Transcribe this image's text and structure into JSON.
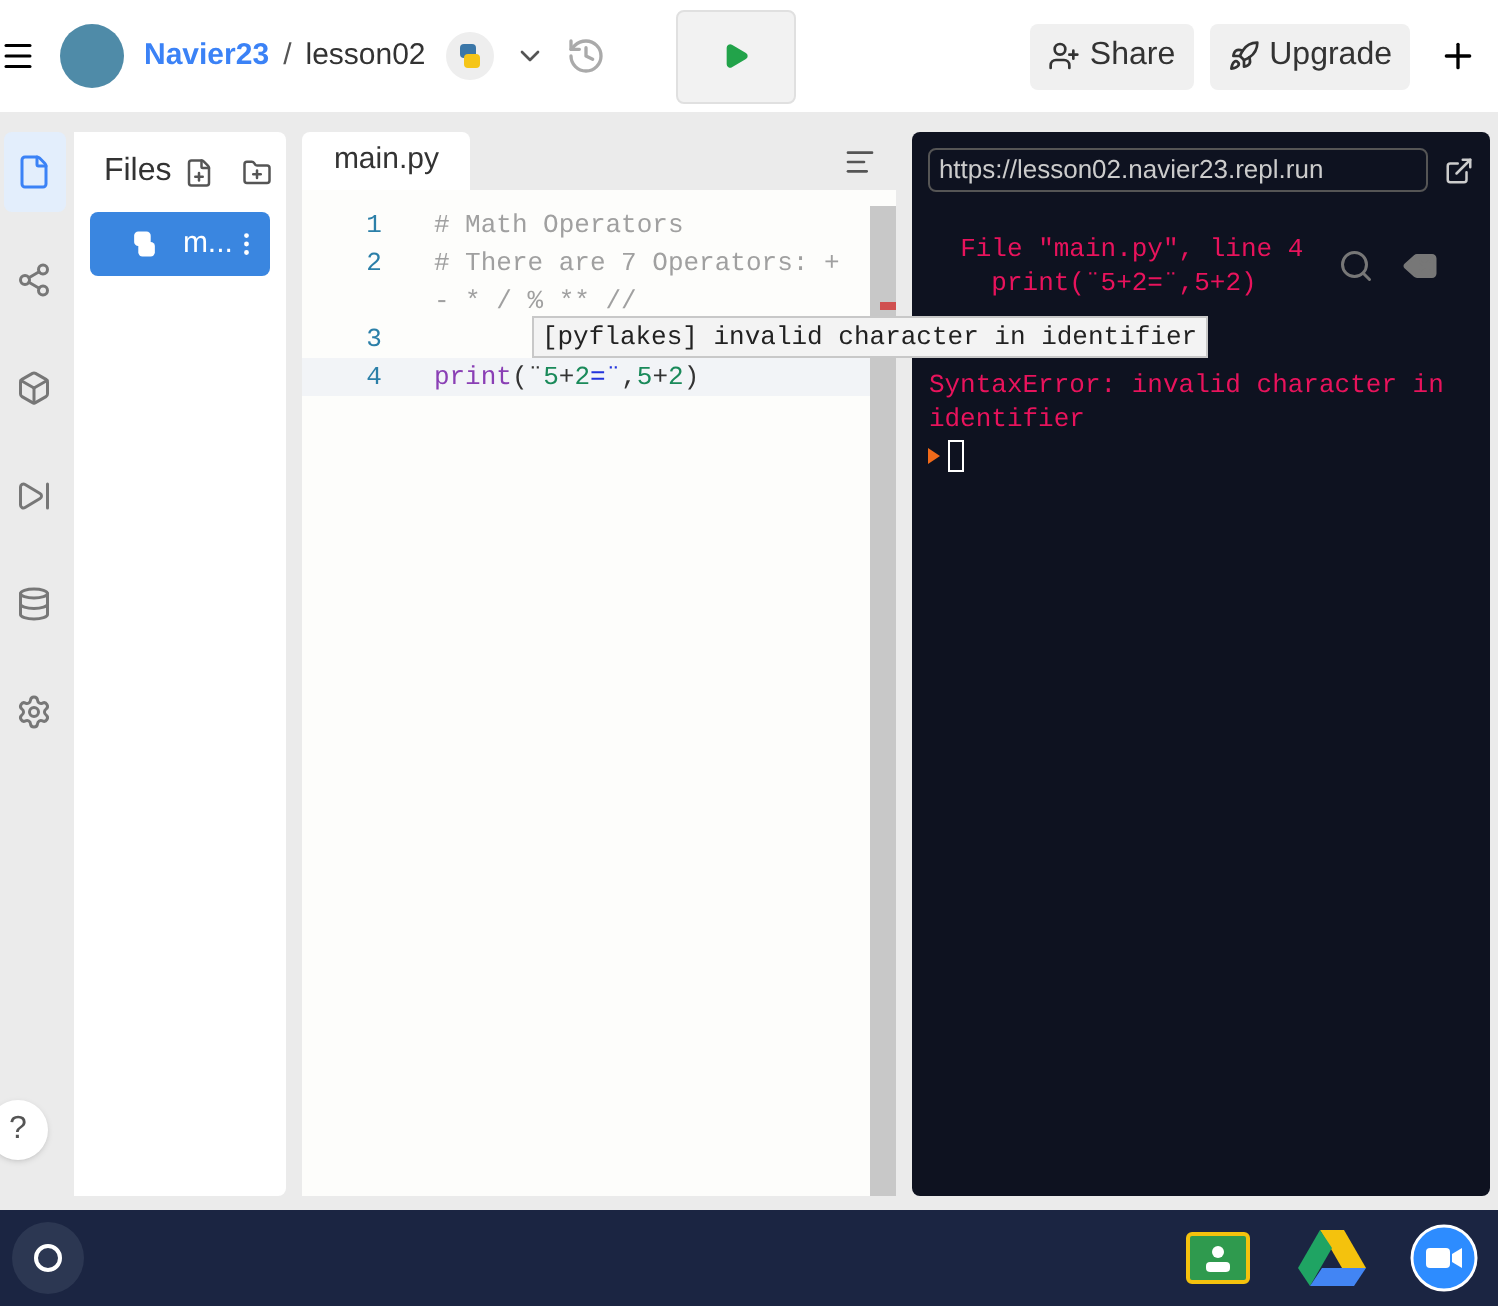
{
  "header": {
    "user": "Navier23",
    "separator": "/",
    "repl": "lesson02",
    "share": "Share",
    "upgrade": "Upgrade"
  },
  "rail": [
    {
      "kind": "files",
      "selected": true
    },
    {
      "kind": "share",
      "selected": false
    },
    {
      "kind": "packages",
      "selected": false
    },
    {
      "kind": "debugger",
      "selected": false
    },
    {
      "kind": "database",
      "selected": false
    },
    {
      "kind": "settings",
      "selected": false
    }
  ],
  "help": "?",
  "files": {
    "title": "Files",
    "items": [
      {
        "name": "m...",
        "selected": true
      }
    ]
  },
  "editor": {
    "tab": "main.py",
    "lines": [
      {
        "number": "1",
        "parts": [
          {
            "kind": "comment",
            "text": "# Math Operators"
          }
        ]
      },
      {
        "number": "2",
        "parts": [
          {
            "kind": "comment",
            "text": "# There are 7 Operators: + - * / % ** //"
          }
        ]
      },
      {
        "number": "3"
      },
      {
        "number": "4",
        "parts": [
          {
            "kind": "func",
            "text": "print"
          },
          {
            "kind": "plain",
            "text": "(¨"
          },
          {
            "kind": "num",
            "text": "5"
          },
          {
            "kind": "plain",
            "text": "+"
          },
          {
            "kind": "num",
            "text": "2"
          },
          {
            "kind": "op",
            "text": "=¨"
          },
          {
            "kind": "plain",
            "text": ","
          },
          {
            "kind": "num",
            "text": "5"
          },
          {
            "kind": "plain",
            "text": "+"
          },
          {
            "kind": "num",
            "text": "2"
          },
          {
            "kind": "plain",
            "text": ")"
          }
        ]
      }
    ],
    "tooltip": "[pyflakes] invalid character in identifier"
  },
  "console": {
    "url": "https://lesson02.navier23.repl.run",
    "output": [
      "  File \"main.py\", line 4",
      "    print(¨5+2=¨,5+2)",
      "SyntaxError: invalid character in identifier"
    ]
  }
}
